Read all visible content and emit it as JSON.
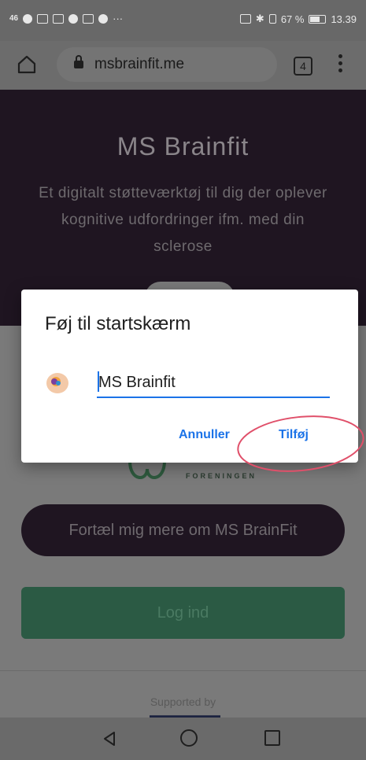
{
  "status_bar": {
    "left_signal": "46",
    "battery_percent": "67 %",
    "time": "13.39",
    "more": "···"
  },
  "browser": {
    "url": "msbrainfit.me",
    "tab_count": "4"
  },
  "hero": {
    "title": "MS Brainfit",
    "subtitle": "Et digitalt støtteværktøj til dig der oplever kognitive udfordringer ifm. med din sclerose"
  },
  "page": {
    "logo_text": "FORENINGEN",
    "more_button": "Fortæl mig mere om MS BrainFit",
    "login_button": "Log ind",
    "supported_by": "Supported by"
  },
  "dialog": {
    "title": "Føj til startskærm",
    "name_value": "MS Brainfit",
    "cancel_label": "Annuller",
    "add_label": "Tilføj"
  },
  "colors": {
    "accent": "#1b73e8",
    "hero_bg": "#1f1521",
    "login_bg": "#2b5a44",
    "highlight": "#e0506a"
  }
}
